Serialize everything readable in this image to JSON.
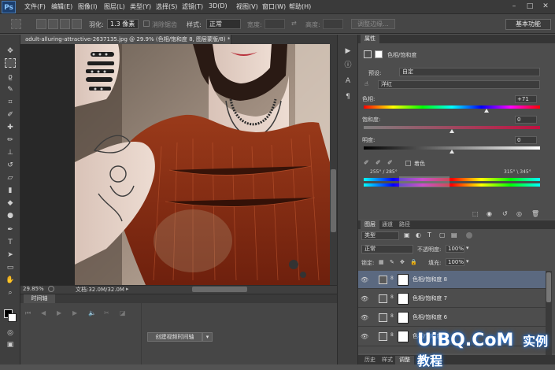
{
  "app": {
    "logo": "Ps",
    "menu": [
      "文件(F)",
      "编辑(E)",
      "图像(I)",
      "图层(L)",
      "类型(Y)",
      "选择(S)",
      "滤镜(T)",
      "3D(D)",
      "视图(V)",
      "窗口(W)",
      "帮助(H)"
    ],
    "window_controls": [
      "–",
      "□",
      "✕"
    ]
  },
  "options_bar": {
    "feather_label": "羽化:",
    "feather_value": "1.3 像素",
    "antialias_label": "消除锯齿",
    "style_label": "样式:",
    "style_value": "正常",
    "width_label": "宽度:",
    "height_label": "高度:",
    "refine_edge": "调整边缘...",
    "workspace": "基本功能"
  },
  "document": {
    "tab_title": "adult-alluring-attractive-2637135.jpg @ 29.9% (色相/饱和度 8, 图层蒙版/8) * ×",
    "zoom": "29.85%",
    "doc_info": "文档:32.0M/32.0M"
  },
  "timeline": {
    "tab": "时间轴",
    "create_button": "创建视频时间轴"
  },
  "properties": {
    "tab": "属性",
    "header": "色相/饱和度",
    "preset_label": "预设:",
    "preset_value": "自定",
    "channel_value": "洋红",
    "hue_label": "色相:",
    "hue_value": "+71",
    "hue_level": 71,
    "saturation_label": "饱和度:",
    "saturation_value": "0",
    "saturation_level": 0,
    "lightness_label": "明度:",
    "lightness_value": "0",
    "lightness_level": 0,
    "colorize_label": "着色",
    "range_left": "255° / 285°",
    "range_right": "315° \\ 345°"
  },
  "layers_panel": {
    "tabs": [
      "图层",
      "通道",
      "路径"
    ],
    "filter_kind": "类型",
    "blend_mode": "正常",
    "opacity_label": "不透明度:",
    "opacity_value": "100%",
    "lock_label": "锁定:",
    "fill_label": "填充:",
    "fill_value": "100%",
    "layers": [
      {
        "name": "色相/饱和度 8"
      },
      {
        "name": "色相/饱和度 7"
      },
      {
        "name": "色相/饱和度 6"
      },
      {
        "name": "色相/饱和度 5"
      }
    ]
  },
  "bottom_tabs": [
    "历史",
    "样式",
    "调整"
  ],
  "watermark": "UiBQ.CoM",
  "watermark_cn": "实例教程",
  "colors": {
    "selection_row": "#5b6980",
    "shirt": "#8a2e14"
  }
}
